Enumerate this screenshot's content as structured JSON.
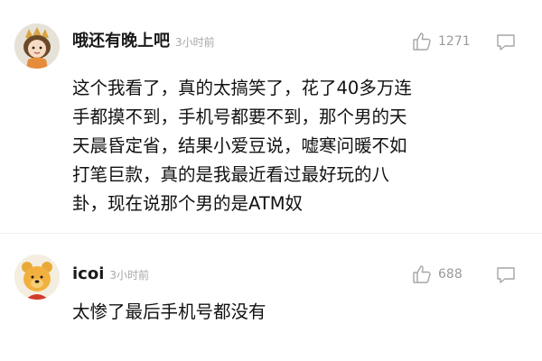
{
  "comments": [
    {
      "username": "哦还有晚上吧",
      "time": "3小时前",
      "likes": "1271",
      "avatar_icon": "cartoon-girl-avatar",
      "lines": [
        "这个我看了，真的太搞笑了，花了40多万连",
        "手都摸不到，手机号都要不到，那个男的天",
        "天晨昏定省，结果小爱豆说，嘘寒问暖不如",
        "打笔巨款，真的是我最近看过最好玩的八",
        "卦，现在说那个男的是ATM奴"
      ]
    },
    {
      "username": "icoi",
      "time": "3小时前",
      "likes": "688",
      "avatar_icon": "winnie-the-pooh-avatar",
      "lines": [
        "太惨了最后手机号都没有"
      ]
    }
  ],
  "icons": {
    "like": "thumbs-up-icon",
    "reply": "comment-bubble-icon"
  },
  "colors": {
    "username": "#1a1a1a",
    "time": "#a8a8a8",
    "count": "#9a9a9a",
    "body": "#111111"
  }
}
